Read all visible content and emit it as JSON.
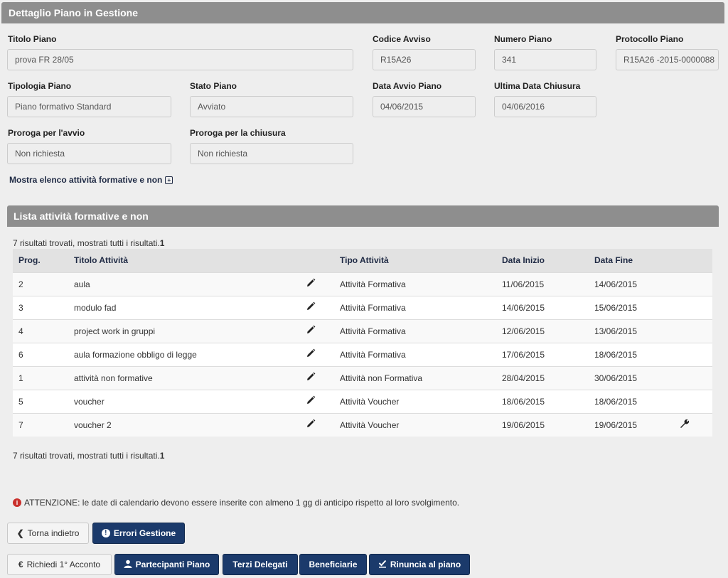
{
  "header": {
    "title": "Dettaglio Piano in Gestione"
  },
  "fields": {
    "titolo_piano": {
      "label": "Titolo Piano",
      "value": "prova FR 28/05"
    },
    "codice_avviso": {
      "label": "Codice Avviso",
      "value": "R15A26"
    },
    "numero_piano": {
      "label": "Numero Piano",
      "value": "341"
    },
    "protocollo_piano": {
      "label": "Protocollo Piano",
      "value": "R15A26 -2015-0000088"
    },
    "tipologia_piano": {
      "label": "Tipologia Piano",
      "value": "Piano formativo Standard"
    },
    "stato_piano": {
      "label": "Stato Piano",
      "value": "Avviato"
    },
    "data_avvio": {
      "label": "Data Avvio Piano",
      "value": "04/06/2015"
    },
    "ultima_data_chiusura": {
      "label": "Ultima Data Chiusura",
      "value": "04/06/2016"
    },
    "proroga_avvio": {
      "label": "Proroga per l'avvio",
      "value": "Non richiesta"
    },
    "proroga_chiusura": {
      "label": "Proroga per la chiusura",
      "value": "Non richiesta"
    }
  },
  "toggle": {
    "label": "Mostra elenco attività formative e non",
    "icon": "plus-box-icon"
  },
  "list_panel": {
    "title": "Lista attività formative e non"
  },
  "results": {
    "text": "7 risultati trovati, mostrati tutti i risultati.",
    "page": "1"
  },
  "table": {
    "headers": {
      "prog": "Prog.",
      "titolo": "Titolo Attività",
      "tipo": "Tipo Attività",
      "inizio": "Data Inizio",
      "fine": "Data Fine"
    },
    "rows": [
      {
        "prog": "2",
        "titolo": "aula",
        "tipo": "Attività Formativa",
        "inizio": "11/06/2015",
        "fine": "14/06/2015"
      },
      {
        "prog": "3",
        "titolo": "modulo fad",
        "tipo": "Attività Formativa",
        "inizio": "14/06/2015",
        "fine": "15/06/2015"
      },
      {
        "prog": "4",
        "titolo": "project work in gruppi",
        "tipo": "Attività Formativa",
        "inizio": "12/06/2015",
        "fine": "13/06/2015"
      },
      {
        "prog": "6",
        "titolo": "aula formazione obbligo di legge",
        "tipo": "Attività Formativa",
        "inizio": "17/06/2015",
        "fine": "18/06/2015"
      },
      {
        "prog": "1",
        "titolo": "attività non formative",
        "tipo": "Attività non Formativa",
        "inizio": "28/04/2015",
        "fine": "30/06/2015"
      },
      {
        "prog": "5",
        "titolo": "voucher",
        "tipo": "Attività Voucher",
        "inizio": "18/06/2015",
        "fine": "18/06/2015"
      },
      {
        "prog": "7",
        "titolo": "voucher 2",
        "tipo": "Attività Voucher",
        "inizio": "19/06/2015",
        "fine": "19/06/2015"
      }
    ]
  },
  "warning": {
    "text": "ATTENZIONE: le date di calendario devono essere inserite con almeno 1 gg di anticipo rispetto al loro svolgimento.",
    "icon_glyph": "i"
  },
  "buttons": {
    "back": "Torna indietro",
    "errori": "Errori Gestione",
    "acconto": "Richiedi 1° Acconto",
    "partecipanti": "Partecipanti Piano",
    "terzi": "Terzi Delegati",
    "beneficiarie": "Beneficiarie",
    "rinuncia": "Rinuncia al piano"
  },
  "colors": {
    "primary": "#1b3a6b",
    "panel_header": "#8e8e8e",
    "warning": "#c9302c"
  }
}
